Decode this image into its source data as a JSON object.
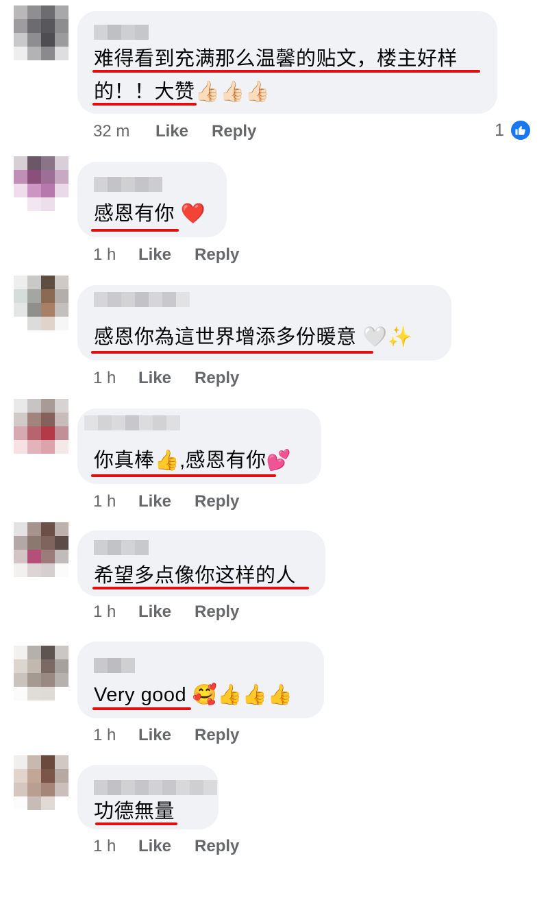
{
  "colors": {
    "bubble": "#f0f2f5",
    "underline": "#e01010",
    "meta": "#65676b",
    "like_blue": "#1877f2"
  },
  "actions": {
    "like_label": "Like",
    "reply_label": "Reply"
  },
  "comments": [
    {
      "lines": [
        "难得看到充满那么温馨的贴文，楼主好样",
        "的！！大赞👍🏻👍🏻👍🏻"
      ],
      "time": "32 m",
      "reaction_count": "1",
      "reaction_icon": "like-icon"
    },
    {
      "lines": [
        "感恩有你 ❤️"
      ],
      "time": "1 h"
    },
    {
      "lines": [
        "感恩你為這世界增添多份暖意 🤍✨"
      ],
      "time": "1 h"
    },
    {
      "lines": [
        "你真棒👍,感恩有你💕"
      ],
      "time": "1 h"
    },
    {
      "lines": [
        "希望多点像你这样的人"
      ],
      "time": "1 h"
    },
    {
      "lines": [
        "Very good 🥰👍👍👍"
      ],
      "time": "1 h"
    },
    {
      "lines": [
        "功德無量"
      ],
      "time": "1 h"
    }
  ]
}
